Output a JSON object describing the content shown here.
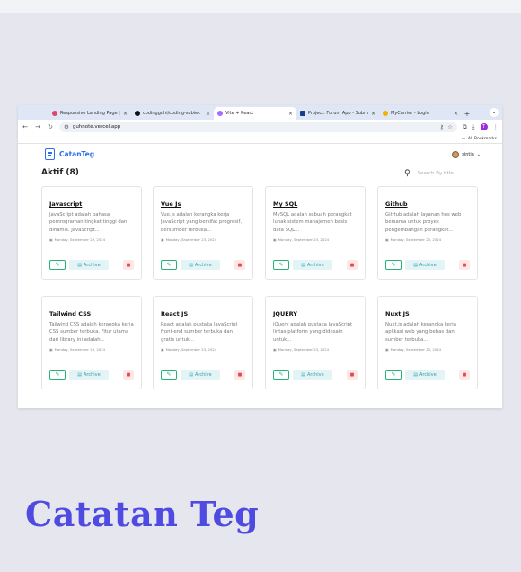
{
  "browser": {
    "tabs": [
      {
        "title": "Responsive Landing Page |",
        "fav_color": "#e0456a",
        "active": false
      },
      {
        "title": "codingguhi/coding-subiec",
        "fav_color": "#111111",
        "active": false
      },
      {
        "title": "Vite + React",
        "fav_color": "#a66bff",
        "active": true
      },
      {
        "title": "Project: Forum App - Subm",
        "fav_color": "#1b3c8c",
        "active": false
      },
      {
        "title": "MyCarrier - Login",
        "fav_color": "#f0b400",
        "active": false
      }
    ],
    "tab_close": "×",
    "new_tab": "+",
    "tab_menu": "⌄",
    "url": "guhnote.vercel.app",
    "profile_initial": "T",
    "bookmarks_label": "All Bookmarks"
  },
  "app": {
    "brand": "CatanTeg",
    "user_name": "sintia",
    "section_title": "Aktif (8)",
    "search_placeholder": "Search By title ...",
    "archive_label": "Archive",
    "notes": [
      {
        "title": "Javascript",
        "desc": "JavaScript adalah bahasa pemrograman tingkat tinggi dan dinamis. JavaScript...",
        "date": "Monday, September 23, 2024"
      },
      {
        "title": "Vue Js",
        "desc": "Vue.js adalah kerangka kerja JavaScript yang bersifat progresif, bersumber terbuka...",
        "date": "Monday, September 23, 2024"
      },
      {
        "title": "My SQL",
        "desc": "MySQL adalah sebuah perangkat lunak sistem manajemen basis data SQL...",
        "date": "Monday, September 23, 2024"
      },
      {
        "title": "Github",
        "desc": "GitHub adalah layanan hos web bersama untuk proyek pengembangan perangkat...",
        "date": "Monday, September 23, 2024"
      },
      {
        "title": "Tailwind CSS",
        "desc": "Tailwind CSS adalah kerangka kerja CSS sumber terbuka. Fitur utama dari library ini adalah...",
        "date": "Monday, September 23, 2024"
      },
      {
        "title": "React JS",
        "desc": "React adalah pustaka JavaScript front-end sumber terbuka dan gratis untuk...",
        "date": "Monday, September 23, 2024"
      },
      {
        "title": "JQUERY",
        "desc": "jQuery adalah pustaka JavaScript lintas-platform yang didesain untuk...",
        "date": "Monday, September 23, 2024"
      },
      {
        "title": "Nuxt JS",
        "desc": "Nuxt.js adalah kerangka kerja aplikasi web yang bebas dan sumber terbuka...",
        "date": "Monday, September 23, 2024"
      }
    ]
  },
  "caption": "Catatan Teg"
}
